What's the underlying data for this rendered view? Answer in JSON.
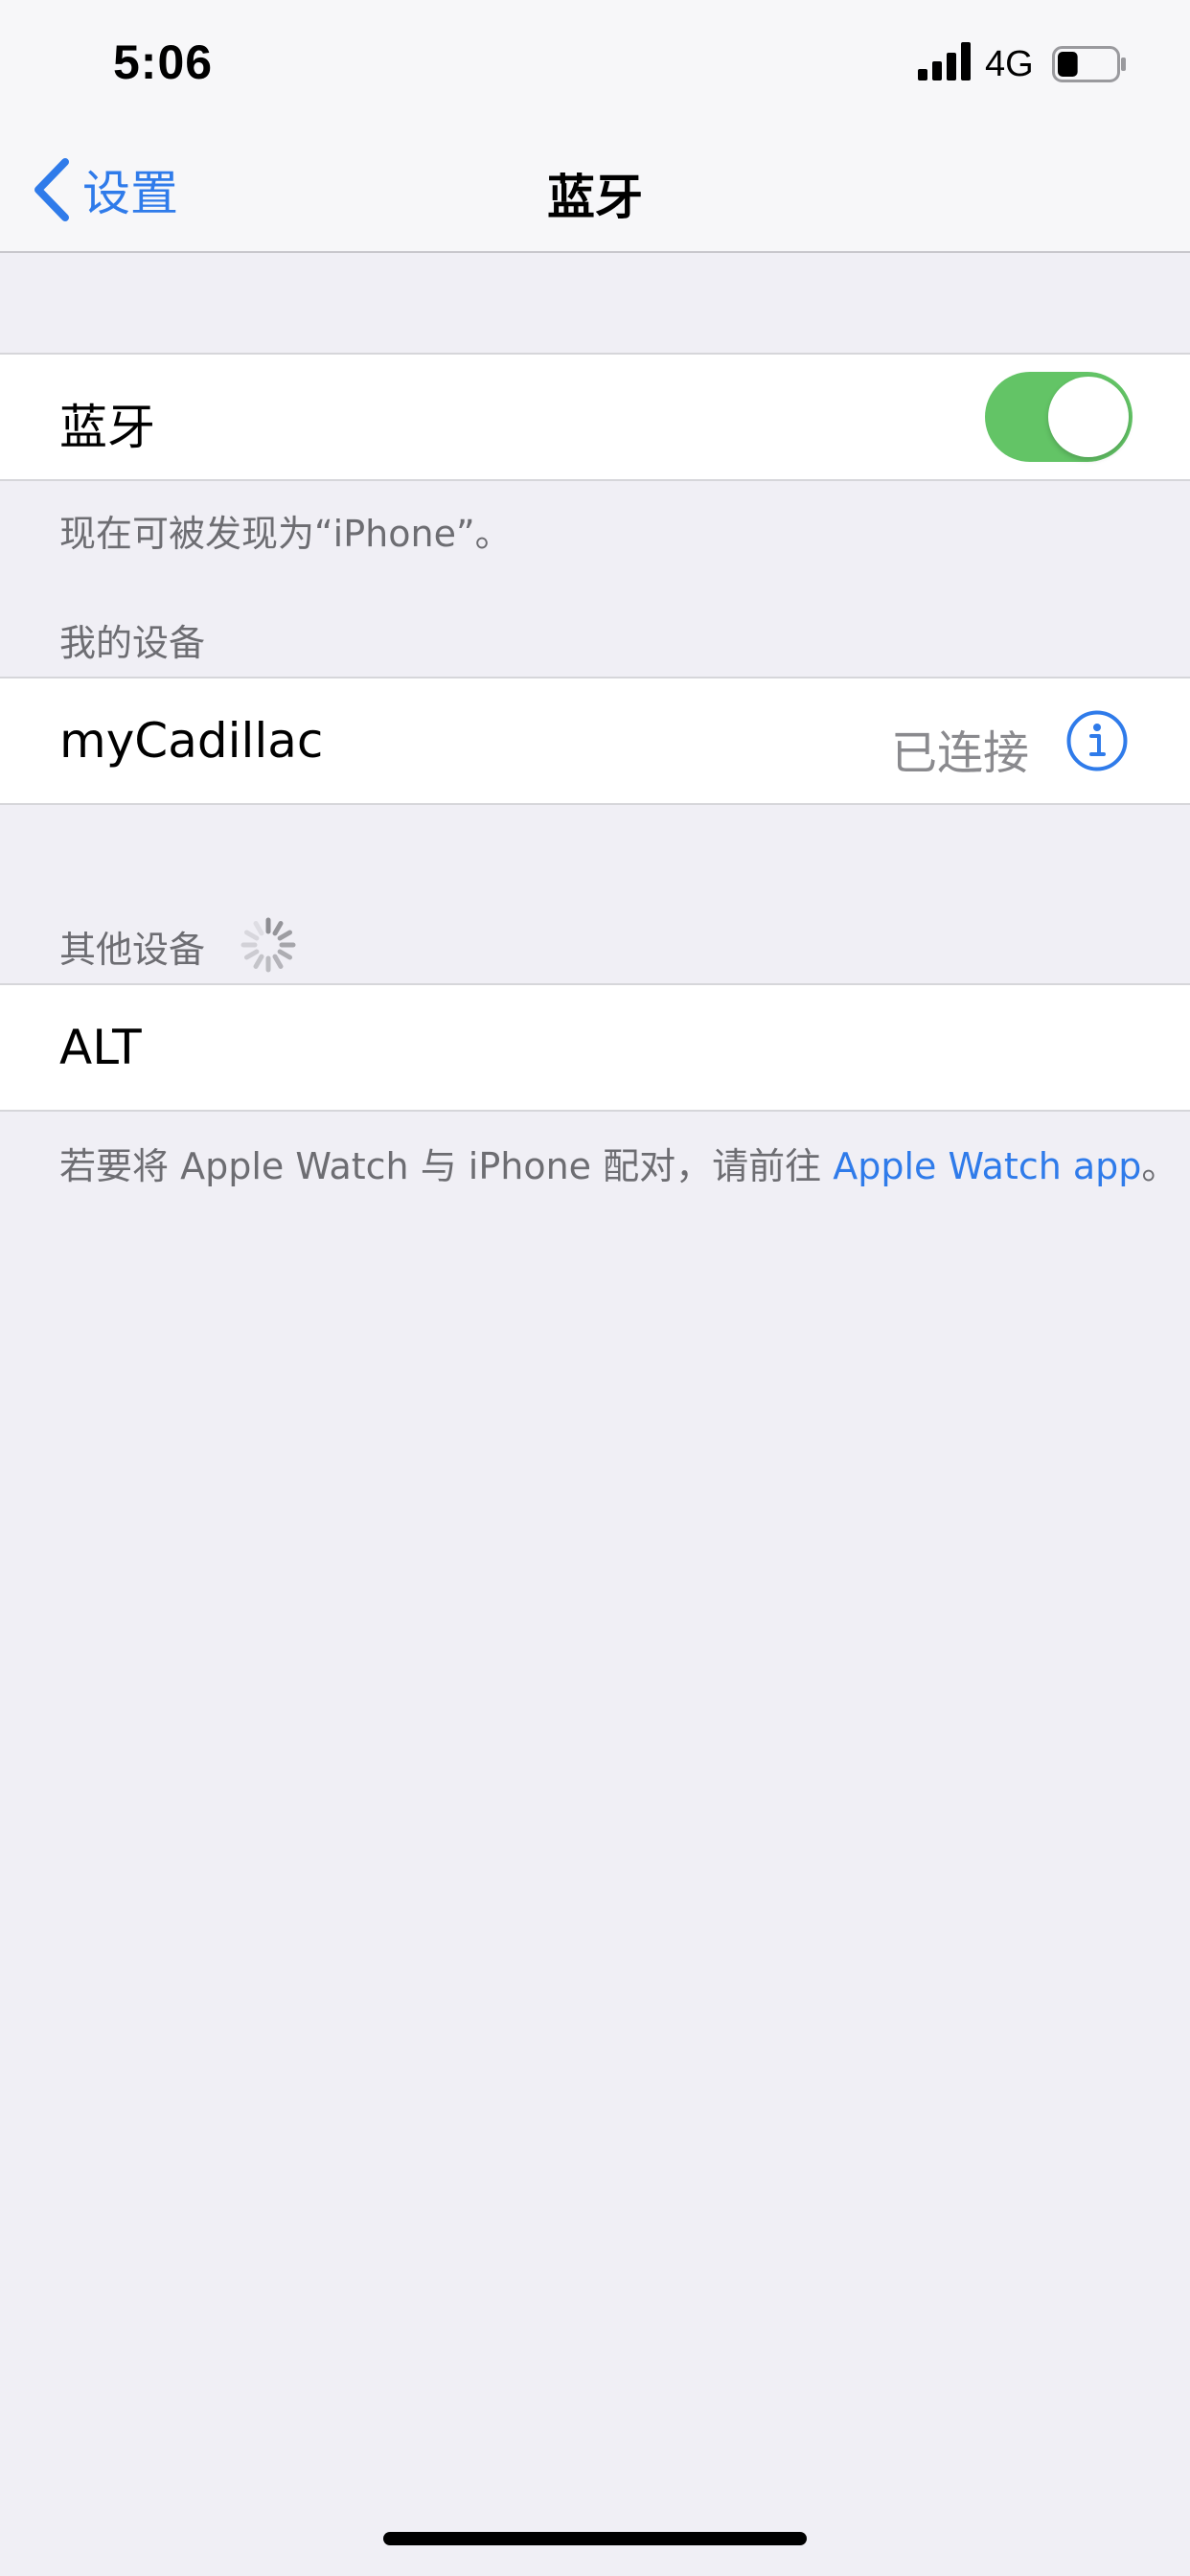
{
  "status_bar": {
    "time": "5:06",
    "network": "4G",
    "signal_bars": 4,
    "battery_level": 0.35,
    "icons": [
      "cellular-signal-icon",
      "battery-icon"
    ]
  },
  "nav": {
    "back_label": "设置",
    "title": "蓝牙",
    "icons": [
      "chevron-left-icon"
    ]
  },
  "bluetooth": {
    "label": "蓝牙",
    "enabled": true,
    "toggle_color": "#63c466",
    "discoverable_note": "现在可被发现为“iPhone”。"
  },
  "my_devices": {
    "header": "我的设备",
    "items": [
      {
        "name": "myCadillac",
        "status": "已连接"
      }
    ]
  },
  "other_devices": {
    "header": "其他设备",
    "items": [
      {
        "name": "ALT"
      }
    ]
  },
  "footer": {
    "text": "若要将 Apple Watch 与 iPhone 配对，请前往 ",
    "link": "Apple Watch app",
    "suffix": "。"
  },
  "colors": {
    "accent": "#2f7bea",
    "background": "#f0eff5",
    "secondary_text": "#6d6d72"
  }
}
